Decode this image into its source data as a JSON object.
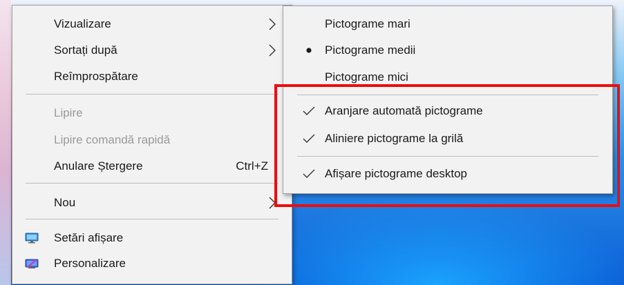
{
  "context_menu": {
    "items": [
      {
        "label": "Vizualizare",
        "submenu": true
      },
      {
        "label": "Sortați după",
        "submenu": true
      },
      {
        "label": "Reîmprospătare"
      },
      {
        "label": "Lipire",
        "disabled": true
      },
      {
        "label": "Lipire comandă rapidă",
        "disabled": true
      },
      {
        "label": "Anulare Ștergere",
        "shortcut": "Ctrl+Z"
      },
      {
        "label": "Nou",
        "submenu": true
      },
      {
        "label": "Setări afișare",
        "icon": "display-settings-icon"
      },
      {
        "label": "Personalizare",
        "icon": "personalize-icon"
      }
    ]
  },
  "view_submenu": {
    "items": [
      {
        "label": "Pictograme mari"
      },
      {
        "label": "Pictograme medii",
        "selected": true
      },
      {
        "label": "Pictograme mici"
      },
      {
        "label": "Aranjare automată pictograme",
        "checked": true
      },
      {
        "label": "Aliniere pictograme la grilă",
        "checked": true
      },
      {
        "label": "Afișare pictograme desktop",
        "checked": true
      }
    ]
  },
  "colors": {
    "menu_background": "#f2f2f2",
    "disabled_text": "#9a9a9a",
    "highlight_box": "#ee0c0c",
    "desktop_blue": "#0a5fd6"
  }
}
